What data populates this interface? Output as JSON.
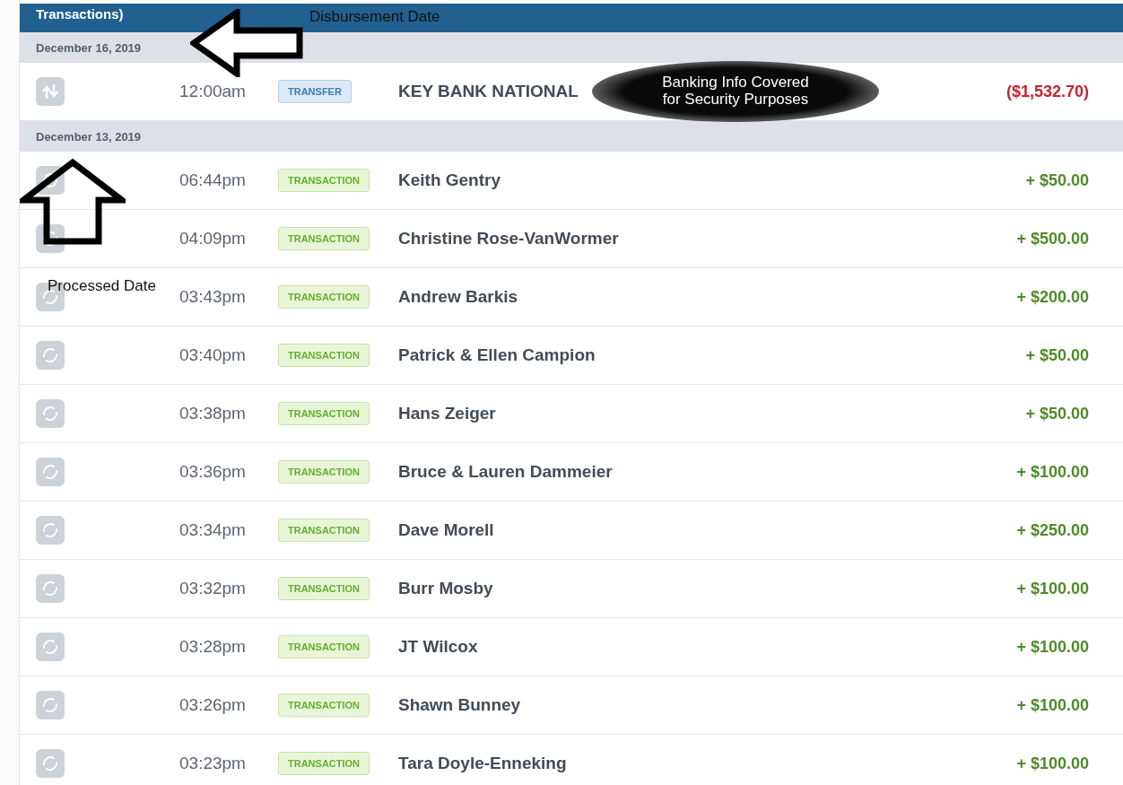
{
  "header": {
    "title": "Transactions)"
  },
  "groups": [
    {
      "date": "December 16, 2019",
      "rows": [
        {
          "kind": "transfer",
          "time": "12:00am",
          "badge": "TRANSFER",
          "name": "KEY BANK NATIONAL",
          "amount": "($1,532.70)"
        }
      ]
    },
    {
      "date": "December 13, 2019",
      "rows": [
        {
          "kind": "transaction",
          "time": "06:44pm",
          "badge": "TRANSACTION",
          "name": "Keith Gentry",
          "amount": "+ $50.00"
        },
        {
          "kind": "transaction",
          "time": "04:09pm",
          "badge": "TRANSACTION",
          "name": "Christine Rose-VanWormer",
          "amount": "+ $500.00"
        },
        {
          "kind": "transaction",
          "time": "03:43pm",
          "badge": "TRANSACTION",
          "name": "Andrew Barkis",
          "amount": "+ $200.00"
        },
        {
          "kind": "transaction",
          "time": "03:40pm",
          "badge": "TRANSACTION",
          "name": "Patrick & Ellen Campion",
          "amount": "+ $50.00"
        },
        {
          "kind": "transaction",
          "time": "03:38pm",
          "badge": "TRANSACTION",
          "name": "Hans Zeiger",
          "amount": "+ $50.00"
        },
        {
          "kind": "transaction",
          "time": "03:36pm",
          "badge": "TRANSACTION",
          "name": "Bruce & Lauren Dammeier",
          "amount": "+ $100.00"
        },
        {
          "kind": "transaction",
          "time": "03:34pm",
          "badge": "TRANSACTION",
          "name": "Dave Morell",
          "amount": "+ $250.00"
        },
        {
          "kind": "transaction",
          "time": "03:32pm",
          "badge": "TRANSACTION",
          "name": "Burr Mosby",
          "amount": "+ $100.00"
        },
        {
          "kind": "transaction",
          "time": "03:28pm",
          "badge": "TRANSACTION",
          "name": "JT Wilcox",
          "amount": "+ $100.00"
        },
        {
          "kind": "transaction",
          "time": "03:26pm",
          "badge": "TRANSACTION",
          "name": "Shawn Bunney",
          "amount": "+ $100.00"
        },
        {
          "kind": "transaction",
          "time": "03:23pm",
          "badge": "TRANSACTION",
          "name": "Tara Doyle-Enneking",
          "amount": "+ $100.00"
        }
      ]
    }
  ],
  "annotations": [
    {
      "kind": "label",
      "text": "Disbursement Date"
    },
    {
      "kind": "arrow_left"
    },
    {
      "kind": "redaction",
      "text": "Banking Info Covered\nfor Security Purposes"
    },
    {
      "kind": "arrow_up"
    },
    {
      "kind": "label",
      "text": "Processed Date"
    }
  ]
}
